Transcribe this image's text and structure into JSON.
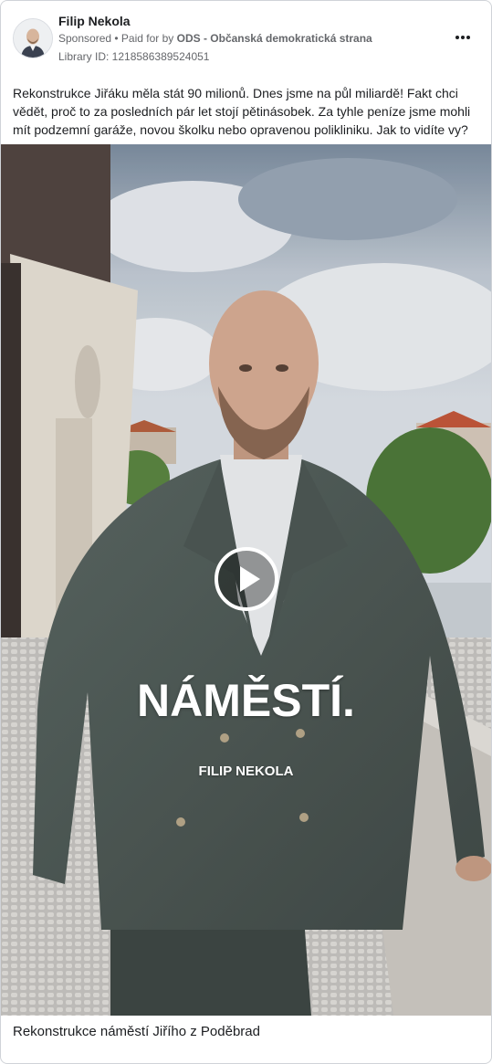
{
  "post": {
    "author": "Filip Nekola",
    "sponsored_label": "Sponsored",
    "separator": " • ",
    "paid_for_prefix": "Paid for by ",
    "paid_for_org": "ODS - Občanská demokratická strana",
    "library_id": "Library ID: 1218586389524051",
    "body": "Rekonstrukce Jiřáku měla stát 90 milionů. Dnes jsme na půl miliardě! Fakt chci vědět, proč to za posledních pár let stojí pětinásobek. Za tyhle peníze jsme mohli mít podzemní garáže, novou školku nebo opravenou polikliniku. Jak to vidíte vy?"
  },
  "video": {
    "overlay_title": "NÁMĚSTÍ.",
    "overlay_subtitle": "FILIP NEKOLA"
  },
  "caption": "Rekonstrukce náměstí Jiřího z Poděbrad",
  "icons": {
    "avatar": "avatar-photo",
    "more": "more-options-icon",
    "play": "play-icon"
  },
  "colors": {
    "primary_text": "#1c1e21",
    "secondary_text": "#65676b",
    "border": "#d0d3d8"
  }
}
